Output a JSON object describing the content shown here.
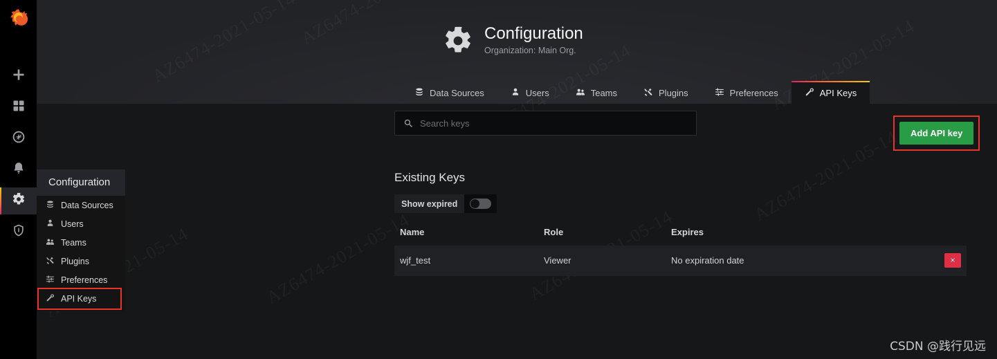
{
  "app": {
    "logo_icon": "grafana-logo-icon",
    "watermark_diagonal": "AZ6474-2021-05-14",
    "watermark_corner": "CSDN @践行见远",
    "accent_gradient_start": "#e0226e",
    "accent_gradient_end": "#f2cc0c",
    "annotation_color": "#e8352a"
  },
  "rail": {
    "items": [
      {
        "name": "create-icon",
        "icon": "plus-icon",
        "active": false
      },
      {
        "name": "dashboards-icon",
        "icon": "apps-icon",
        "active": false
      },
      {
        "name": "explore-icon",
        "icon": "compass-icon",
        "active": false
      },
      {
        "name": "alerting-icon",
        "icon": "bell-icon",
        "active": false
      },
      {
        "name": "configuration-icon",
        "icon": "gear-icon",
        "active": true
      },
      {
        "name": "admin-icon",
        "icon": "shield-icon",
        "active": false
      }
    ]
  },
  "flyout": {
    "header": "Configuration",
    "items": [
      {
        "label": "Data Sources",
        "icon": "database-icon",
        "highlighted": false
      },
      {
        "label": "Users",
        "icon": "user-icon",
        "highlighted": false
      },
      {
        "label": "Teams",
        "icon": "users-icon",
        "highlighted": false
      },
      {
        "label": "Plugins",
        "icon": "plugin-icon",
        "highlighted": false
      },
      {
        "label": "Preferences",
        "icon": "sliders-icon",
        "highlighted": false
      },
      {
        "label": "API Keys",
        "icon": "key-icon",
        "highlighted": true
      }
    ]
  },
  "header": {
    "icon": "gear-icon",
    "title": "Configuration",
    "subtitle": "Organization: Main Org."
  },
  "tabs": [
    {
      "label": "Data Sources",
      "icon": "database-icon",
      "active": false
    },
    {
      "label": "Users",
      "icon": "user-icon",
      "active": false
    },
    {
      "label": "Teams",
      "icon": "users-icon",
      "active": false
    },
    {
      "label": "Plugins",
      "icon": "plugin-icon",
      "active": false
    },
    {
      "label": "Preferences",
      "icon": "sliders-icon",
      "active": false
    },
    {
      "label": "API Keys",
      "icon": "key-icon",
      "active": true
    }
  ],
  "search": {
    "icon": "search-icon",
    "value": "",
    "placeholder": "Search keys"
  },
  "add_key_button": {
    "label": "Add API key",
    "color": "#299c46",
    "annotated": true
  },
  "existing_keys": {
    "title": "Existing Keys",
    "show_expired": {
      "label": "Show expired",
      "enabled": false
    },
    "columns": [
      "Name",
      "Role",
      "Expires"
    ],
    "rows": [
      {
        "name": "wjf_test",
        "role": "Viewer",
        "expires": "No expiration date",
        "delete_icon": "close-icon"
      }
    ]
  }
}
